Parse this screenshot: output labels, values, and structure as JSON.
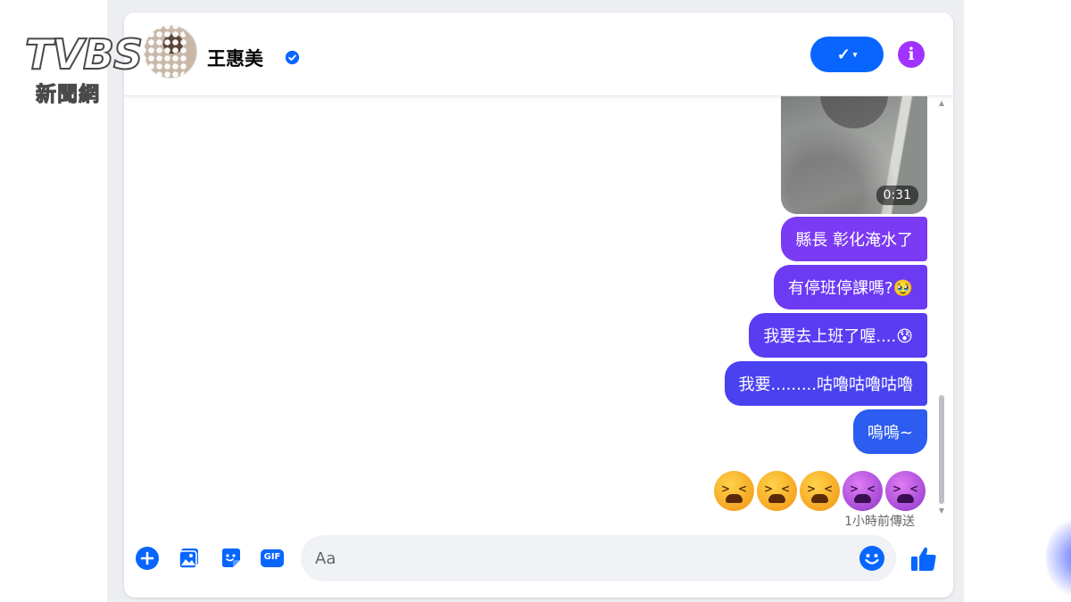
{
  "header": {
    "contact_name": "王惠美",
    "call_label": "✓",
    "call_caret": "▾",
    "info_label": "i"
  },
  "conversation": {
    "video_duration": "0:31",
    "messages": [
      {
        "text": "縣長 彰化淹水了",
        "color": "#7b3af3"
      },
      {
        "text": "有停班停課嗎?🥹",
        "color": "#6c39f4"
      },
      {
        "text": "我要去上班了喔....😰",
        "color": "#5a3cf3"
      },
      {
        "text": "我要.........咕嚕咕嚕咕嚕",
        "color": "#4a42f0"
      },
      {
        "text": "嗚嗚~",
        "color": "#2c5cf0"
      }
    ],
    "emoji_reactions": [
      "tired-face",
      "tired-face",
      "tired-face",
      "tired-face-purple",
      "tired-face-purple"
    ],
    "sent_status": "1小時前傳送"
  },
  "composer": {
    "placeholder": "Aa",
    "gif_label": "GIF"
  },
  "watermark": {
    "logo": "TVBS",
    "subtitle": "新聞網"
  },
  "colors": {
    "accent": "#0866ff",
    "info": "#a033ff",
    "verified": "#0866ff"
  }
}
